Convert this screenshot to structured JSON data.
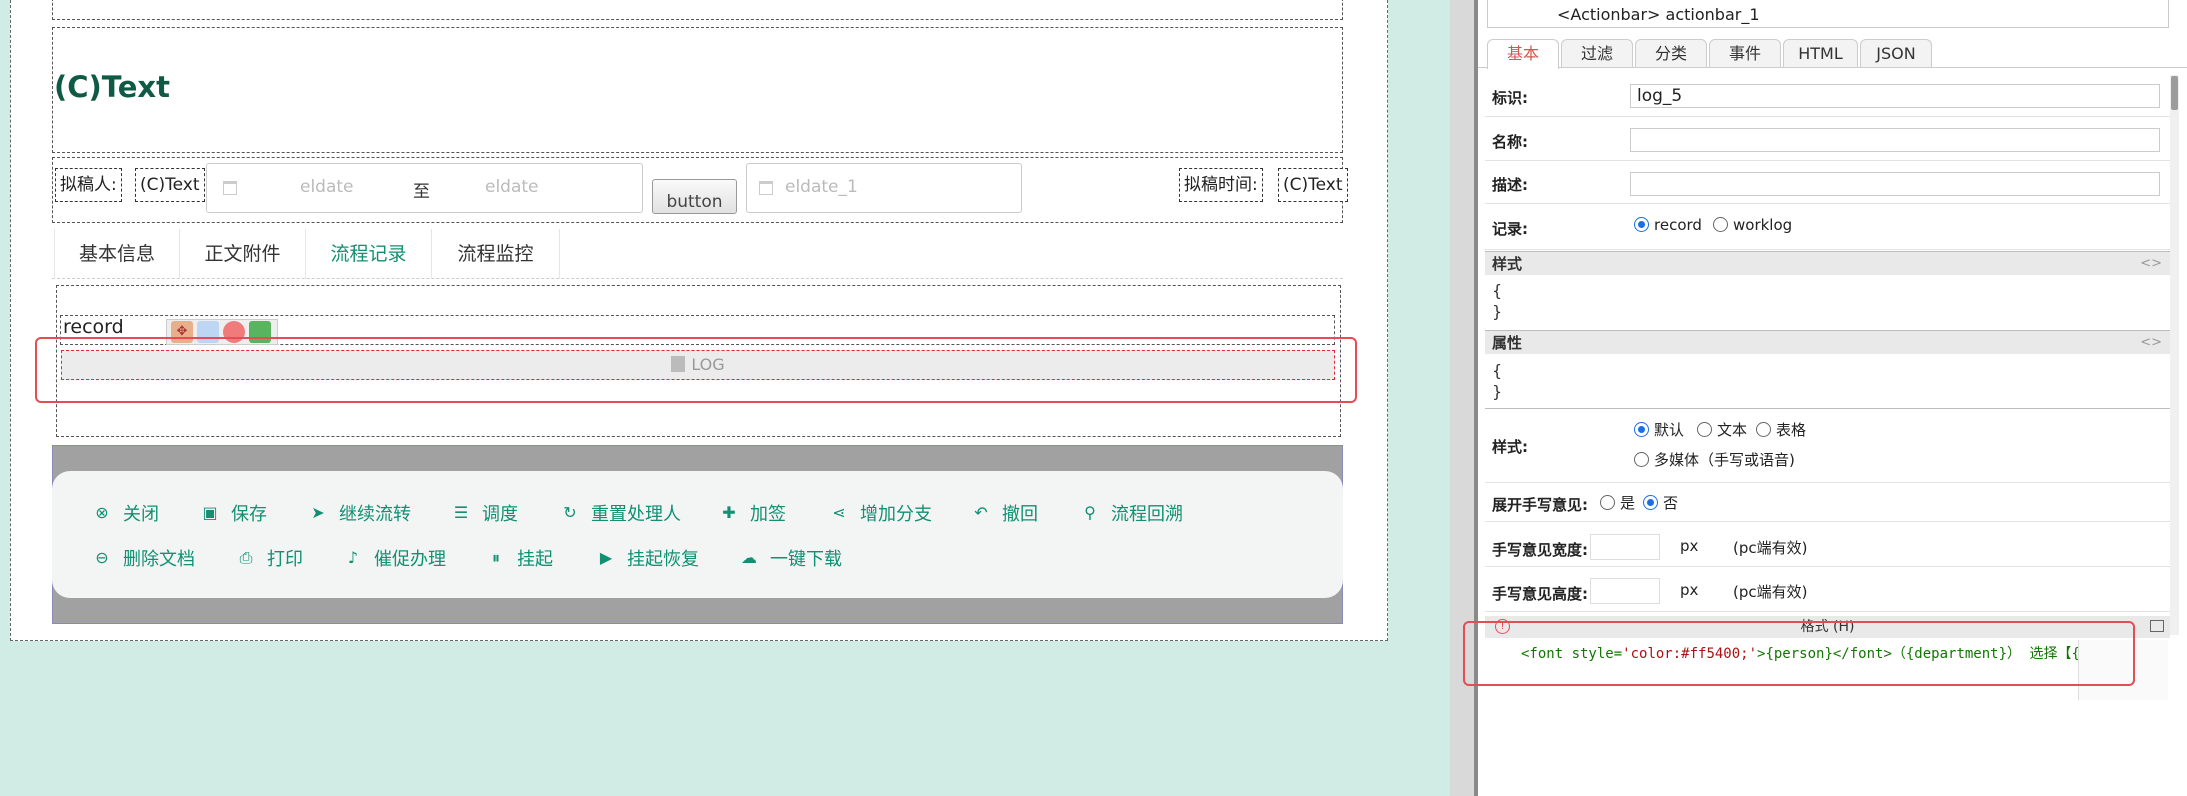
{
  "form": {
    "text_title": "(C)Text",
    "drafter_label": "拟稿人:",
    "drafter_value": "(C)Text",
    "date_start_placeholder": "eldate",
    "date_sep": "至",
    "date_end_placeholder": "eldate",
    "button_label": "button",
    "date1_placeholder": "eldate_1",
    "draft_time_label": "拟稿时间:",
    "draft_time_value": "(C)Text",
    "tabs": [
      "基本信息",
      "正文附件",
      "流程记录",
      "流程监控"
    ],
    "active_tab": "流程记录",
    "record_label": "record",
    "log_label": "LOG"
  },
  "actions": {
    "row1": [
      "关闭",
      "保存",
      "继续流转",
      "调度",
      "重置处理人",
      "加签",
      "增加分支",
      "撤回",
      "流程回溯"
    ],
    "row2": [
      "删除文档",
      "打印",
      "催促办理",
      "挂起",
      "挂起恢复",
      "一键下载"
    ]
  },
  "panel": {
    "tree_item": "<Actionbar> actionbar_1",
    "tabs": [
      "基本",
      "过滤",
      "分类",
      "事件",
      "HTML",
      "JSON"
    ],
    "active_tab": "基本",
    "id_label": "标识:",
    "id_value": "log_5",
    "name_label": "名称:",
    "desc_label": "描述:",
    "record_label": "记录:",
    "record_opt1": "record",
    "record_opt2": "worklog",
    "style_section": "样式",
    "attr_section": "属性",
    "brace_open": "{",
    "brace_close": "}",
    "style_label": "样式:",
    "style_opts": [
      "默认",
      "文本",
      "表格",
      "多媒体（手写或语音)"
    ],
    "expand_label": "展开手写意见:",
    "yes": "是",
    "no": "否",
    "hw_width_label": "手写意见宽度:",
    "hw_height_label": "手写意见高度:",
    "px": "px",
    "pc_note": "(pc端有效)",
    "format_head": "格式 (H)",
    "format_code_1": "<font style=",
    "format_code_2": "'color:#ff5400;'",
    "format_code_3": ">{person}</font>（{department}） 选择【{"
  },
  "colors": {
    "accent": "#119072",
    "highlight": "#e44c56",
    "canvas_bg": "#d1ece4"
  }
}
